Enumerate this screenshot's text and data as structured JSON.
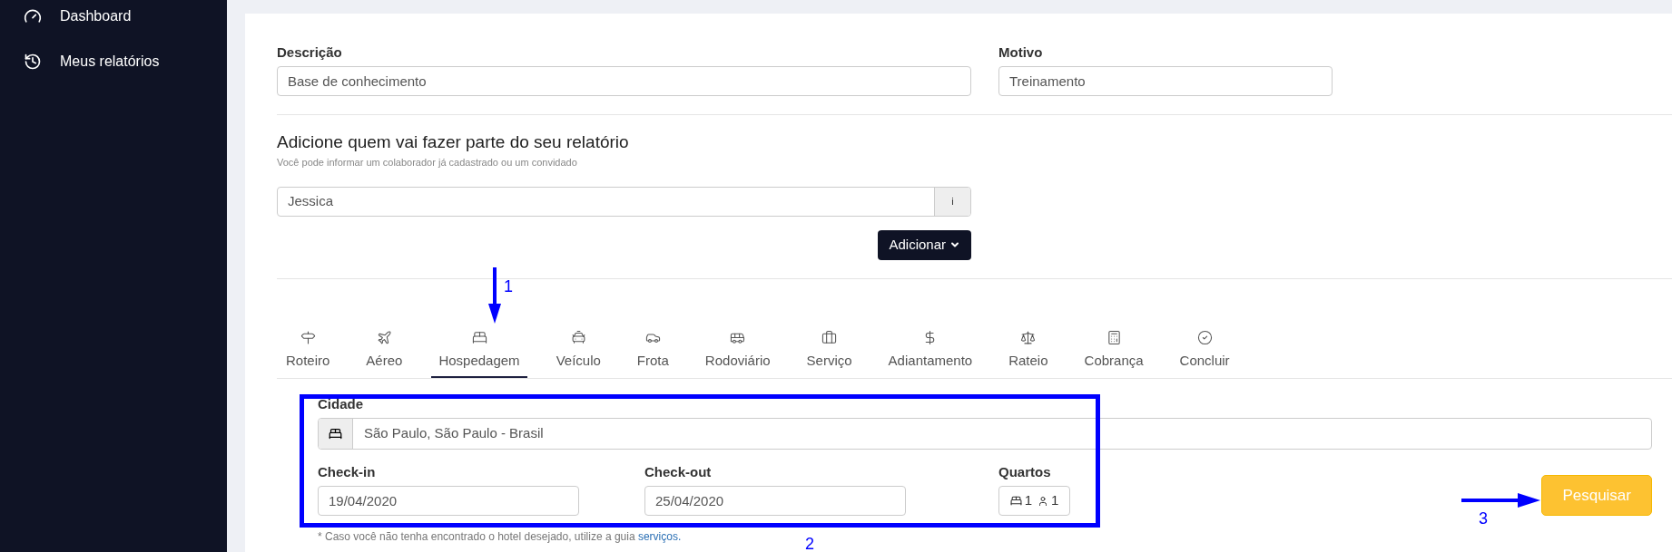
{
  "sidebar": {
    "items": [
      {
        "label": "Dashboard"
      },
      {
        "label": "Meus relatórios"
      }
    ]
  },
  "form": {
    "description": {
      "label": "Descrição",
      "value": "Base de conhecimento"
    },
    "reason": {
      "label": "Motivo",
      "value": "Treinamento"
    }
  },
  "participants": {
    "title": "Adicione quem vai fazer parte do seu relatório",
    "subtitle": "Você pode informar um colaborador já cadastrado ou um convidado",
    "value": "Jessica",
    "addon": "i",
    "add_button": "Adicionar"
  },
  "tabs": [
    {
      "label": "Roteiro",
      "selected": false
    },
    {
      "label": "Aéreo",
      "selected": false
    },
    {
      "label": "Hospedagem",
      "selected": true
    },
    {
      "label": "Veículo",
      "selected": false
    },
    {
      "label": "Frota",
      "selected": false
    },
    {
      "label": "Rodoviário",
      "selected": false
    },
    {
      "label": "Serviço",
      "selected": false
    },
    {
      "label": "Adiantamento",
      "selected": false
    },
    {
      "label": "Rateio",
      "selected": false
    },
    {
      "label": "Cobrança",
      "selected": false
    },
    {
      "label": "Concluir",
      "selected": false
    }
  ],
  "hotel_search": {
    "city": {
      "label": "Cidade",
      "value": "São Paulo, São Paulo - Brasil"
    },
    "checkin": {
      "label": "Check-in",
      "value": "19/04/2020"
    },
    "checkout": {
      "label": "Check-out",
      "value": "25/04/2020"
    },
    "rooms": {
      "label": "Quartos",
      "rooms": "1",
      "guests": "1"
    },
    "search_button": "Pesquisar",
    "note": "* Caso você não tenha encontrado o hotel desejado, utilize a guia",
    "note_link": "serviços."
  },
  "annotations": [
    {
      "label": "1"
    },
    {
      "label": "2"
    },
    {
      "label": "3"
    }
  ]
}
